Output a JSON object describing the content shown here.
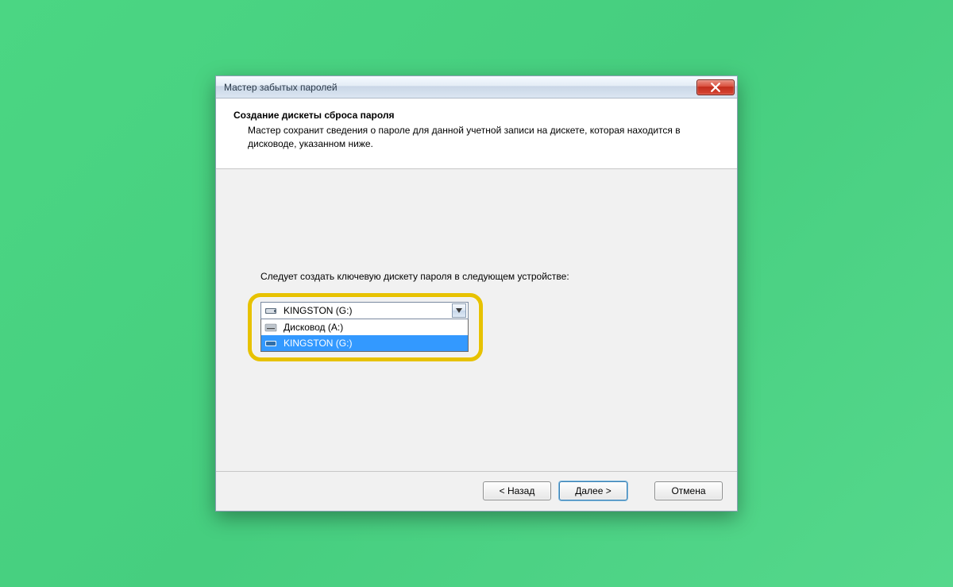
{
  "window": {
    "title": "Мастер забытых паролей"
  },
  "header": {
    "title": "Создание дискеты сброса пароля",
    "subtitle": "Мастер сохранит сведения о пароле для данной учетной записи на дискете, которая находится в дисководе, указанном ниже."
  },
  "body": {
    "instruction": "Следует создать ключевую дискету пароля в следующем устройстве:",
    "combo": {
      "selected_label": "KINGSTON (G:)",
      "options": [
        {
          "label": "Дисковод (A:)",
          "icon": "floppy-drive-icon",
          "selected": false
        },
        {
          "label": "KINGSTON (G:)",
          "icon": "usb-drive-icon",
          "selected": true
        }
      ]
    }
  },
  "footer": {
    "back": "< Назад",
    "next": "Далее >",
    "cancel": "Отмена"
  }
}
